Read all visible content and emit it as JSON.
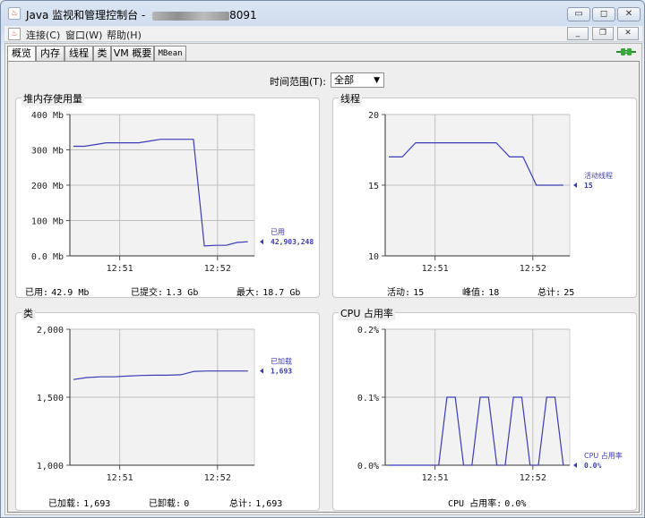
{
  "window": {
    "title_prefix": "Java 监视和管理控制台 - ",
    "title_suffix": "8091",
    "app_icon": "java-cup-icon",
    "buttons": {
      "minimize": "▭",
      "maximize": "◻",
      "close": "✕"
    }
  },
  "menubar": {
    "items": [
      "连接(C)",
      "窗口(W)",
      "帮助(H)"
    ],
    "mdi_buttons": {
      "minimize": "_",
      "restore": "❐",
      "close": "✕"
    }
  },
  "tabs": [
    "概览",
    "内存",
    "线程",
    "类",
    "VM 概要",
    "MBean"
  ],
  "active_tab": 0,
  "time_range": {
    "label": "时间范围(T):",
    "value": "全部"
  },
  "panels": {
    "heap": {
      "title": "堆内存使用量",
      "stats": [
        {
          "label": "已用:",
          "value": "42.9  Mb"
        },
        {
          "label": "已提交:",
          "value": "1.3  Gb"
        },
        {
          "label": "最大:",
          "value": "18.7  Gb"
        }
      ],
      "legend_name": "已用",
      "legend_value": "42,903,248"
    },
    "threads": {
      "title": "线程",
      "stats": [
        {
          "label": "活动:",
          "value": "15"
        },
        {
          "label": "峰值:",
          "value": "18"
        },
        {
          "label": "总计:",
          "value": "25"
        }
      ],
      "legend_name": "活动线程",
      "legend_value": "15"
    },
    "classes": {
      "title": "类",
      "stats": [
        {
          "label": "已加载:",
          "value": "1,693"
        },
        {
          "label": "已卸载:",
          "value": "0"
        },
        {
          "label": "总计:",
          "value": "1,693"
        }
      ],
      "legend_name": "已加载",
      "legend_value": "1,693"
    },
    "cpu": {
      "title": "CPU 占用率",
      "stats": [
        {
          "label": "CPU 占用率:",
          "value": "0.0%"
        }
      ],
      "legend_name": "CPU 占用率",
      "legend_value": "0.0%"
    }
  },
  "colors": {
    "series": "#3c3cb4",
    "grid": "#c0c0c0",
    "plot_bg": "#f2f2f2"
  },
  "chart_data": [
    {
      "id": "heap",
      "type": "line",
      "title": "堆内存使用量",
      "y_ticks": [
        "0.0 Mb",
        "100 Mb",
        "200 Mb",
        "300 Mb",
        "400 Mb"
      ],
      "ylim": [
        0,
        400
      ],
      "x_ticks": [
        "12:51",
        "12:52"
      ],
      "x": [
        "12:50.6",
        "12:50.8",
        "12:50.9",
        "12:51.0",
        "12:51.1",
        "12:51.2",
        "12:51.3",
        "12:51.4",
        "12:51.5",
        "12:51.6",
        "12:51.8",
        "12:51.9",
        "12:51.95",
        "12:52.0",
        "12:52.1",
        "12:52.2",
        "12:52.4"
      ],
      "values": [
        310,
        310,
        315,
        320,
        320,
        320,
        320,
        325,
        330,
        330,
        330,
        330,
        28,
        30,
        30,
        38,
        40
      ]
    },
    {
      "id": "threads",
      "type": "line",
      "title": "线程",
      "y_ticks": [
        "10",
        "15",
        "20"
      ],
      "ylim": [
        10,
        20
      ],
      "x_ticks": [
        "12:51",
        "12:52"
      ],
      "values": [
        17,
        17,
        18,
        18,
        18,
        18,
        18,
        18,
        18,
        17,
        17,
        15,
        15,
        15
      ]
    },
    {
      "id": "classes",
      "type": "line",
      "title": "类",
      "y_ticks": [
        "1,000",
        "1,500",
        "2,000"
      ],
      "ylim": [
        1000,
        2000
      ],
      "x_ticks": [
        "12:51",
        "12:52"
      ],
      "values": [
        1630,
        1645,
        1650,
        1650,
        1655,
        1660,
        1662,
        1662,
        1665,
        1690,
        1693,
        1693,
        1693,
        1693
      ]
    },
    {
      "id": "cpu",
      "type": "line",
      "title": "CPU 占用率",
      "y_ticks": [
        "0.0%",
        "0.1%",
        "0.2%"
      ],
      "ylim": [
        0,
        0.2
      ],
      "x_ticks": [
        "12:51",
        "12:52"
      ],
      "values": [
        0,
        0,
        0,
        0,
        0,
        0,
        0,
        0.1,
        0.1,
        0,
        0,
        0.1,
        0.1,
        0,
        0,
        0.1,
        0.1,
        0,
        0,
        0.1,
        0.1,
        0
      ]
    }
  ]
}
